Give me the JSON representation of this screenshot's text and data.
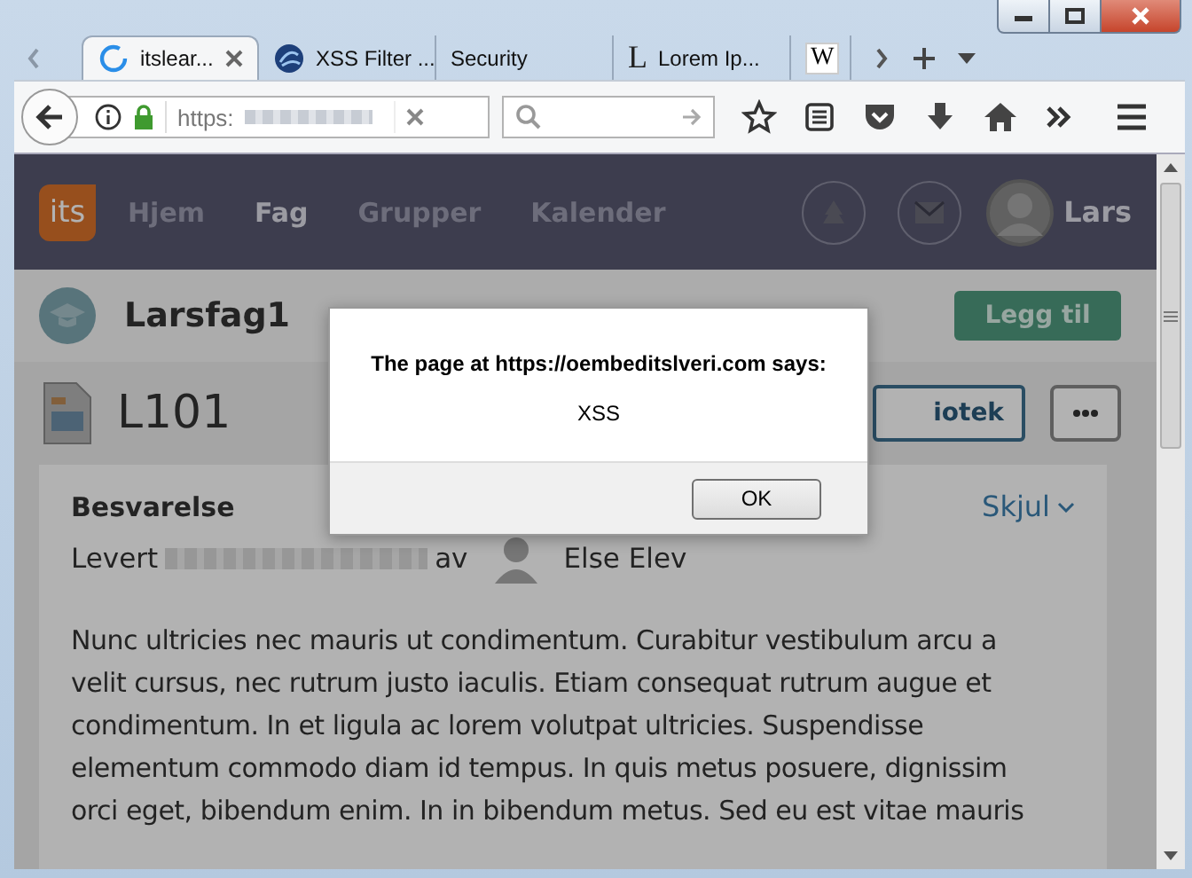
{
  "browser": {
    "tabs": [
      {
        "kind": "loading",
        "label": "itslear...",
        "selected": true
      },
      {
        "kind": "globe",
        "label": "XSS Filter ...",
        "selected": false
      },
      {
        "kind": "none",
        "label": "Security",
        "selected": false
      },
      {
        "kind": "letter",
        "favicon_text": "L",
        "label": "Lorem Ip...",
        "selected": false
      },
      {
        "kind": "letter-box",
        "favicon_text": "W",
        "selected": false
      }
    ],
    "address": {
      "value": "https:"
    }
  },
  "site": {
    "logo": "its",
    "nav": [
      {
        "label": "Hjem",
        "selected": false
      },
      {
        "label": "Fag",
        "selected": true
      },
      {
        "label": "Grupper",
        "selected": false
      },
      {
        "label": "Kalender",
        "selected": false
      }
    ],
    "user": "Lars",
    "course": {
      "title": "Larsfag1",
      "add_button": "Legg til"
    },
    "page": {
      "title": "L101",
      "library_button": "iotek"
    },
    "card": {
      "heading": "Besvarelse",
      "toggle": "Skjul",
      "delivered_label": "Levert",
      "by_label": "av",
      "author": "Else Elev",
      "text": "Nunc ultricies nec mauris ut condimentum. Curabitur vestibulum arcu a velit cursus, nec rutrum justo iaculis. Etiam consequat rutrum augue et condimentum. In et ligula ac lorem volutpat ultricies. Suspendisse elementum commodo diam id tempus. In quis metus posuere, dignissim orci eget, bibendum enim. In in bibendum metus. Sed eu est vitae mauris"
    }
  },
  "dialog": {
    "message": "The page at https://oembeditslveri.com says:",
    "text": "XSS",
    "ok_button": "OK"
  }
}
